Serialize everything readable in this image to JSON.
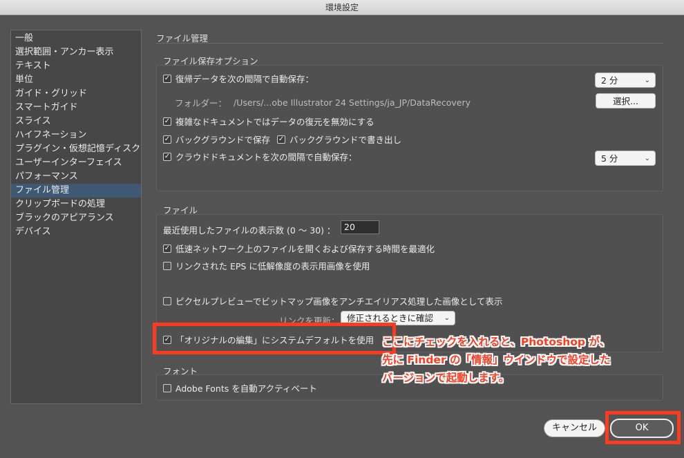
{
  "window": {
    "title": "環境設定"
  },
  "sidebar": {
    "items": [
      {
        "label": "一般"
      },
      {
        "label": "選択範囲・アンカー表示"
      },
      {
        "label": "テキスト"
      },
      {
        "label": "単位"
      },
      {
        "label": "ガイド・グリッド"
      },
      {
        "label": "スマートガイド"
      },
      {
        "label": "スライス"
      },
      {
        "label": "ハイフネーション"
      },
      {
        "label": "プラグイン・仮想記憶ディスク"
      },
      {
        "label": "ユーザーインターフェイス"
      },
      {
        "label": "パフォーマンス"
      },
      {
        "label": "ファイル管理",
        "active": true
      },
      {
        "label": "クリップボードの処理"
      },
      {
        "label": "ブラックのアピアランス"
      },
      {
        "label": "デバイス"
      }
    ]
  },
  "main": {
    "heading": "ファイル管理",
    "save_options": {
      "title": "ファイル保存オプション",
      "autosave_label": "復帰データを次の間隔で自動保存：",
      "autosave_checked": true,
      "autosave_interval": "2 分",
      "folder_label": "フォルダー：",
      "folder_path": "/Users/...obe Illustrator 24 Settings/ja_JP/DataRecovery",
      "choose_button": "選択...",
      "disable_recovery_label": "複雑なドキュメントではデータの復元を無効にする",
      "bg_save_label": "バックグラウンドで保存",
      "bg_export_label": "バックグラウンドで書き出し",
      "cloud_autosave_label": "クラウドドキュメントを次の間隔で自動保存：",
      "cloud_interval": "5 分"
    },
    "files": {
      "title": "ファイル",
      "recent_label": "最近使用したファイルの表示数 (0 〜 30) ：",
      "recent_value": "20",
      "network_label": "低速ネットワーク上のファイルを開くおよび保存する時間を最適化",
      "low_res_label": "リンクされた EPS に低解像度の表示用画像を使用",
      "antialias_label": "ピクセルプレビューでビットマップ画像をアンチエイリアス処理した画像として表示",
      "update_links_label": "リンクを更新：",
      "update_links_value": "修正されるときに確認",
      "original_edit_label": "「オリジナルの編集」にシステムデフォルトを使用"
    },
    "fonts": {
      "title": "フォント",
      "auto_activate_label": "Adobe Fonts を自動アクティベート"
    }
  },
  "annotation": {
    "line1": "ここにチェックを入れると、Photoshop が、",
    "line2": "先に Finder の「情報」ウインドウで設定した",
    "line3": "バージョンで起動します。",
    "color": "#ff3b1f"
  },
  "footer": {
    "cancel_label": "キャンセル",
    "ok_label": "OK"
  }
}
